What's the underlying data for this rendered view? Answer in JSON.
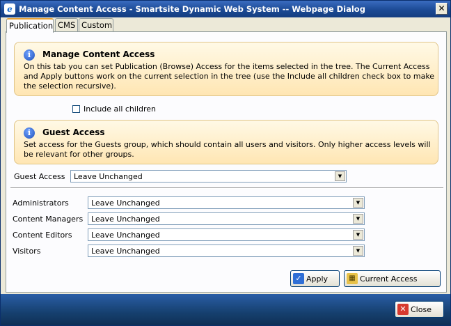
{
  "window": {
    "title": "Manage Content Access - Smartsite Dynamic Web System -- Webpage Dialog",
    "close_glyph": "✕"
  },
  "tabs": [
    {
      "label": "Publication",
      "active": true
    },
    {
      "label": "CMS",
      "active": false
    },
    {
      "label": "Custom",
      "active": false
    }
  ],
  "manage_info": {
    "title": "Manage Content Access",
    "body": "On this tab you can set Publication (Browse) Access for the items selected in the tree. The Current Access and Apply buttons work on the current selection in the tree (use the Include all children check box to make the selection recursive)."
  },
  "include_children": {
    "label": "Include all children",
    "checked": false
  },
  "guest_info": {
    "title": "Guest Access",
    "body": "Set access for the Guests group, which should contain all users and visitors. Only higher access levels will be relevant for other groups."
  },
  "guest_access": {
    "label": "Guest Access",
    "value": "Leave Unchanged"
  },
  "groups": [
    {
      "label": "Administrators",
      "value": "Leave Unchanged"
    },
    {
      "label": "Content Managers",
      "value": "Leave Unchanged"
    },
    {
      "label": "Content Editors",
      "value": "Leave Unchanged"
    },
    {
      "label": "Visitors",
      "value": "Leave Unchanged"
    }
  ],
  "buttons": {
    "apply": "Apply",
    "current_access": "Current Access",
    "close": "Close"
  },
  "icons": {
    "title": "ie-icon",
    "info": "info-icon",
    "apply": "checkmark-icon",
    "current_access": "grid-icon",
    "close": "close-icon"
  },
  "colors": {
    "titlebar": "#1c4a95",
    "footer": "#16406f",
    "info_bg": "#ffe6b3",
    "tab_highlight": "#e6a136"
  }
}
